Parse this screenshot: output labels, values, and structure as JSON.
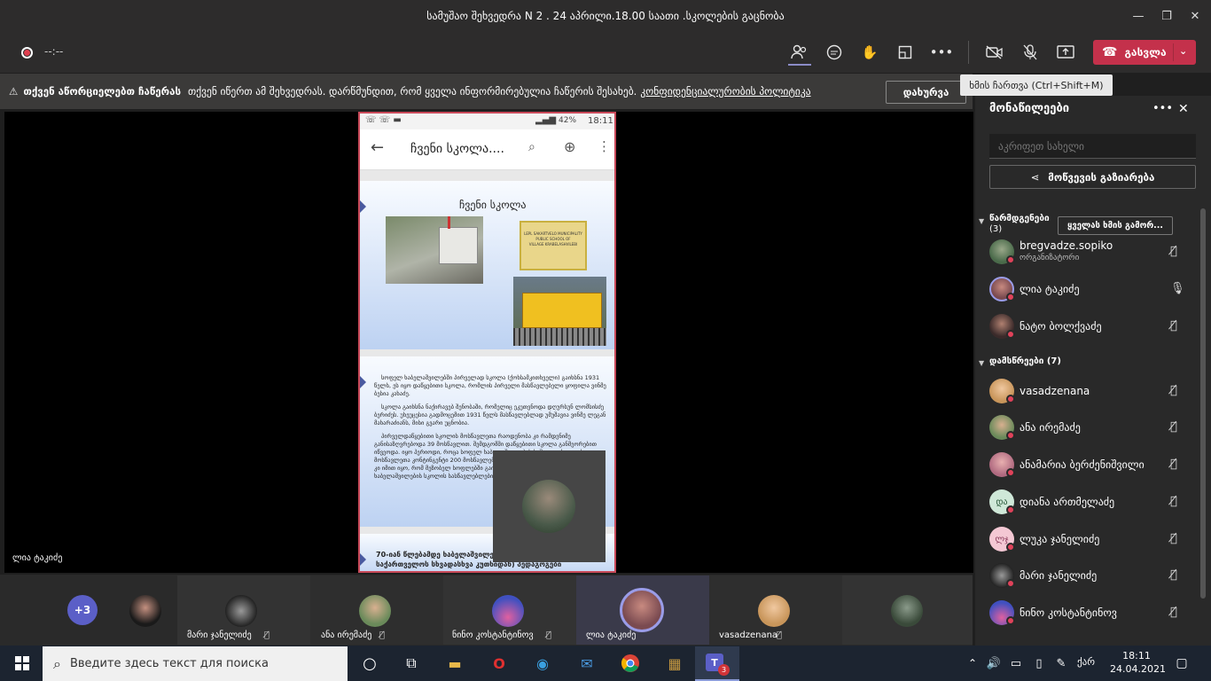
{
  "window": {
    "title": "სამუშაო შეხვედრა N 2 . 24 აპრილი.18.00 საათი .სკოლების გაცნობა"
  },
  "toolbar": {
    "timer": "--:--",
    "leave_label": "გასვლა"
  },
  "banner": {
    "prefix": "თქვენ აწორციელებთ ჩაწერას",
    "text": "თქვენ იწერთ ამ შეხვედრას. დარწმუნდით, რომ ყველა ინფორმირებულია ჩაწერის შესახებ.",
    "link": "კონფიდენციალურობის პოლიტიკა",
    "close_label": "დახურვა"
  },
  "tooltip": "ხმის ჩართვა (Ctrl+Shift+M)",
  "stage": {
    "presenter_name": "ლია ტაკიძე"
  },
  "phone": {
    "status_time": "18:11",
    "battery": "42%",
    "app_title": "ჩვენი სკოლა....",
    "slide1_title": "ჩვენი სკოლა",
    "sign_lines": [
      "LEPL SAKARTVELO MUNICIPALITY",
      "PUBLIC SCHOOL OF",
      "VILLAGE KRABELASHVILEBI"
    ],
    "slide2_p1": "სოფელ ხაბელაშვილებში პირველად სკოლა (ქოხსამკითხველი) გაიხსნა 1931 წელს, ეს იყო დაწყებითი სკოლა, რომლის პირველი მასწავლებელი ყოფილა ვინმე ბესია კახაძე.",
    "slide2_p2": "სკოლა გაიხსნა ნაქირავებ შენობაში, რომელიც ეკუთვნოდა დღურსუნ ლომსისძე ბერიძეს. უხეუცესია გადმოცემით 1931 წელს მასწავლებლად უმუშავია ვინმე ლეგან მახარაძიანს, მისი გვარი უცნობია.",
    "slide2_p3": "პირველდაწყებითი სკოლის მოსწავლეთა რაოდენობა კი რამდენიმე განისაზღვრებოდა 39 მოსწავლით. შემდგომში დაწყებითი სკოლა განმეორებით იწვეოდა. იყო პერიოდი, როცა სოფელ ხაბელაშვილების საშუალო სკოლის მოსწავლეთა კონტინგენტი 200 მოსწავლემდე დღეისათვის იყო 40-ს შეადგენს. ეს კი იმით იყო, რომ მეზობელ სოფლებში გაიხსნა შემდეგ საშუალო სკოლები და ხაბელაშვილების სკოლის სასწავლებლები გაიყო.",
    "slide3_text": "70-იან წლებამდე ხაბელაშვილების სკოლაში მუშაობდნენ ( საქართველოს სხვადასხვა კუთხიდან) პედაგოგები"
  },
  "participants_row": [
    {
      "name": "+3"
    },
    {
      "name": ""
    },
    {
      "name": "მარი ჯანელიძე"
    },
    {
      "name": "ანა ირემაძე"
    },
    {
      "name": "ნინო კოსტანტინოვ"
    },
    {
      "name": "ლია ტაკიძე"
    },
    {
      "name": "vasadzenana"
    },
    {
      "name": ""
    }
  ],
  "panel": {
    "title": "მონაწილეები",
    "search_placeholder": "აკრიფეთ სახელი",
    "share_label": "მოწვევის გაზიარება",
    "presenters_header": "წარმდგენები",
    "presenters_count": "(3)",
    "mute_all_label": "ყველას ხმის გამორ...",
    "presenters": [
      {
        "name": "bregvadze.sopiko",
        "role": "ორგანიზატორი",
        "color": "#5a7a5a"
      },
      {
        "name": "ლია ტაკიძე",
        "role": "",
        "color": "#8a5a60"
      },
      {
        "name": "ნატო ბოლქვაძე",
        "role": "",
        "color": "#4a3a3a"
      }
    ],
    "attendees_header": "დამსწრეები (7)",
    "attendees": [
      {
        "name": "vasadzenana",
        "initials": "",
        "color": "#c8955a"
      },
      {
        "name": "ანა ირემაძე",
        "initials": "",
        "color": "#6a8a5a"
      },
      {
        "name": "ანამარია ბერძენიშვილი",
        "initials": "",
        "color": "#b06a80"
      },
      {
        "name": "დიანა ართმელაძე",
        "initials": "და",
        "color": "#cfe8d8"
      },
      {
        "name": "ლუკა ჯანელიძე",
        "initials": "ლჯ",
        "color": "#f4c8d4"
      },
      {
        "name": "მარი ჯანელიძე",
        "initials": "",
        "color": "#555555"
      },
      {
        "name": "ნინო კოსტანტინოვ",
        "initials": "",
        "color": "#6a5ab0"
      }
    ]
  },
  "taskbar": {
    "search_placeholder": "Введите здесь текст для поиска",
    "time": "18:11",
    "date": "24.04.2021",
    "lang": "ქარ",
    "teams_badge": "3"
  }
}
